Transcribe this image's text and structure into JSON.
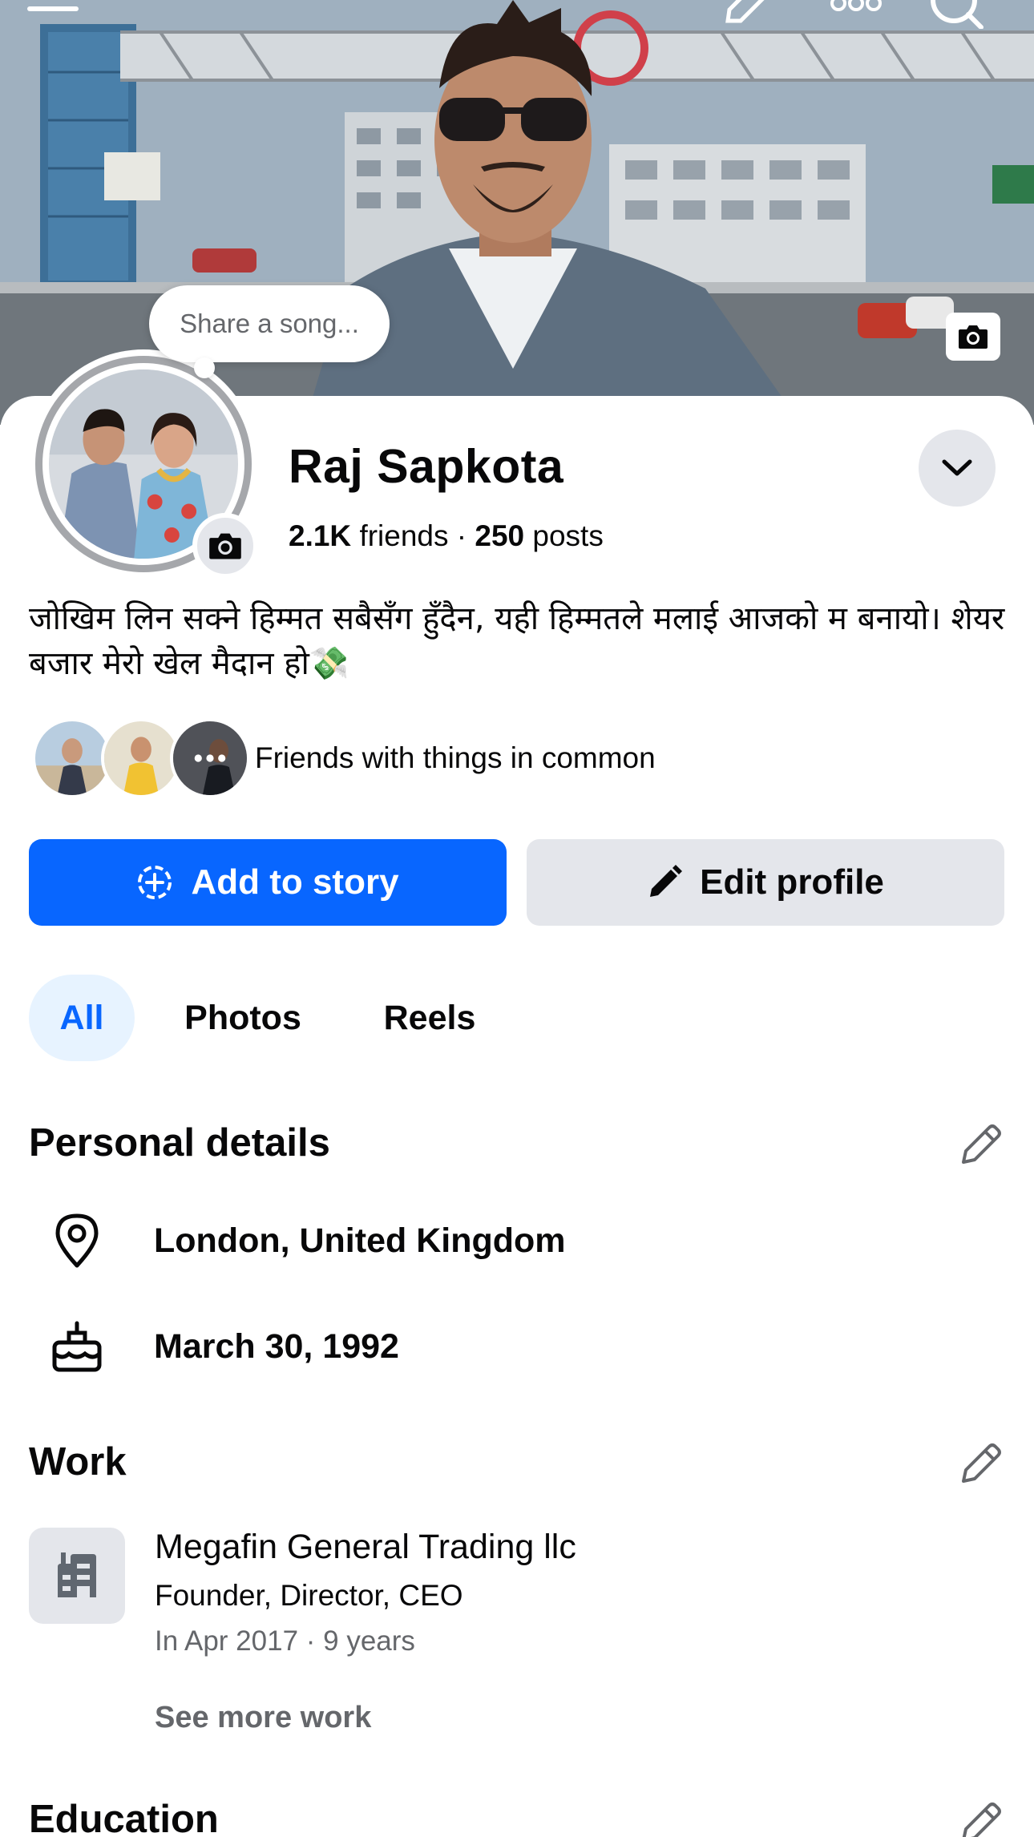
{
  "profile": {
    "name": "Raj Sapkota",
    "friends_count": "2.1K",
    "friends_label": "friends",
    "separator": "·",
    "posts_count": "250",
    "posts_label": "posts",
    "song_prompt": "Share a song...",
    "bio": "जोखिम लिन सक्ने हिम्मत सबैसँग हुँदैन, यही हिम्मतले मलाई आजको म बनायो। शेयर बजार मेरो खेल मैदान हो💸",
    "mutual_text": "Friends with things in common"
  },
  "actions": {
    "add_story": "Add to story",
    "edit_profile": "Edit profile"
  },
  "tabs": [
    {
      "label": "All",
      "active": true
    },
    {
      "label": "Photos",
      "active": false
    },
    {
      "label": "Reels",
      "active": false
    }
  ],
  "personal_details": {
    "title": "Personal details",
    "location": "London, United Kingdom",
    "birthday": "March 30, 1992"
  },
  "work": {
    "title": "Work",
    "company": "Megafin General Trading llc",
    "role": "Founder, Director, CEO",
    "period": "In Apr 2017 · 9 years",
    "see_more": "See more work"
  },
  "education": {
    "title": "Education"
  },
  "icons": {
    "top_left": "menu-icon",
    "top_right": [
      "pencil-icon",
      "more-icon",
      "search-icon"
    ],
    "cover": "camera-icon",
    "location": "map-pin-icon",
    "birthday": "cake-icon",
    "work": "building-icon"
  },
  "colors": {
    "primary": "#0866ff",
    "secondary_bg": "#e4e6eb",
    "tab_active_bg": "#e7f3ff",
    "muted_text": "#65676b"
  }
}
